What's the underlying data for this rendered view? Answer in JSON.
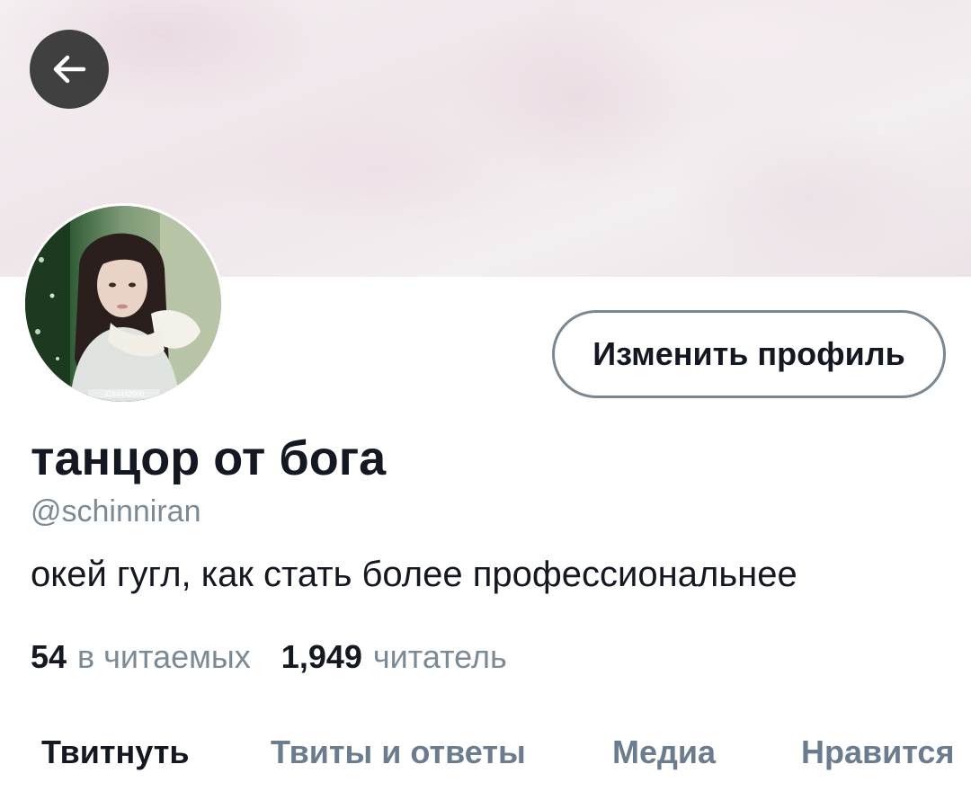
{
  "header": {
    "back_icon": "arrow-left-icon"
  },
  "profile": {
    "display_name": "танцор от бога",
    "handle": "@schinniran",
    "bio": "окей гугл, как стать более профессиональнее",
    "avatar_watermark": "3284442006",
    "edit_button_label": "Изменить профиль"
  },
  "stats": {
    "following_count": "54",
    "following_label": "в читаемых",
    "followers_count": "1,949",
    "followers_label": "читатель"
  },
  "tabs": [
    {
      "label": "Твитнуть",
      "active": true
    },
    {
      "label": "Твиты и ответы",
      "active": false
    },
    {
      "label": "Медиа",
      "active": false
    },
    {
      "label": "Нравится",
      "active": false
    }
  ],
  "colors": {
    "text_primary": "#141823",
    "text_secondary": "#7c8a96",
    "tab_inactive": "#6b7c8f",
    "button_border": "#7b8790",
    "back_button_bg": "#282828"
  }
}
